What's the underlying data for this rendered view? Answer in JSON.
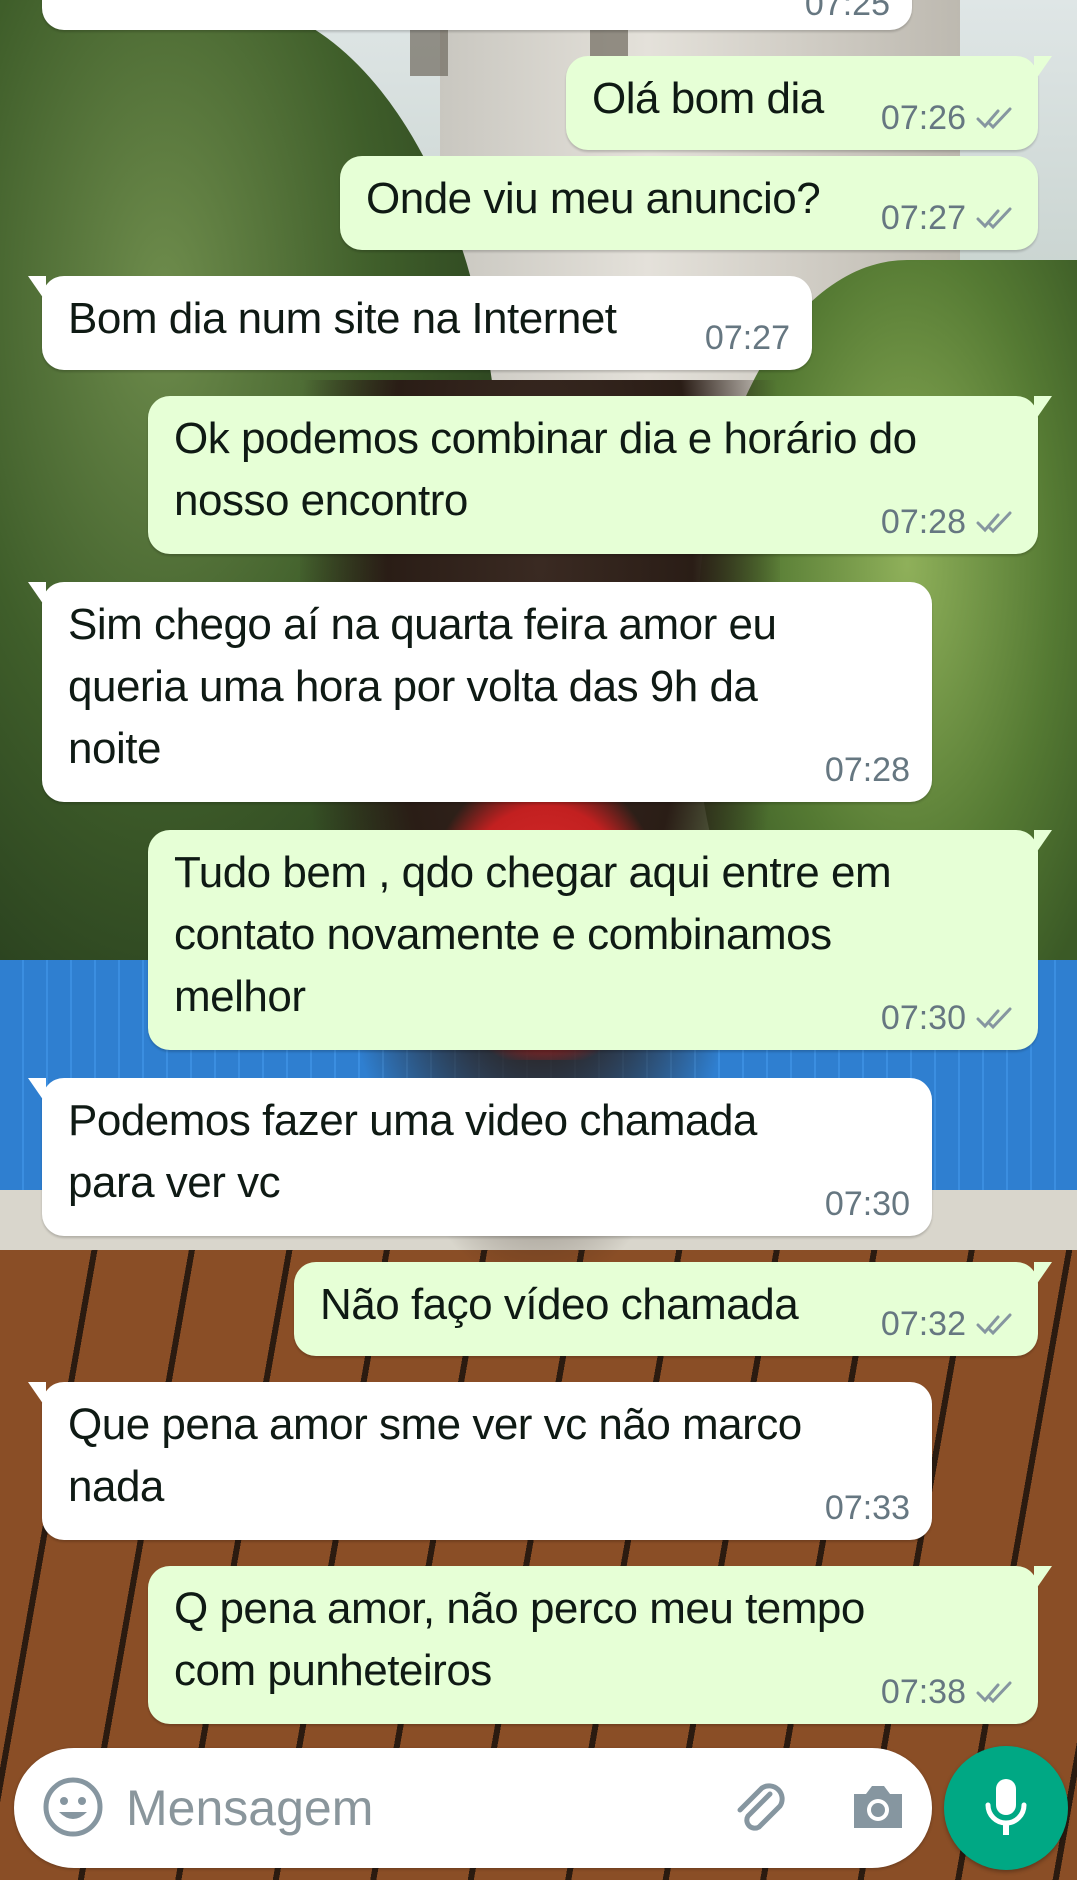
{
  "conversation": {
    "partial_top": {
      "time": "07:25"
    },
    "messages": [
      {
        "dir": "out",
        "text": "Olá bom dia",
        "time": "07:26"
      },
      {
        "dir": "out",
        "text": "Onde viu meu anuncio?",
        "time": "07:27"
      },
      {
        "dir": "in",
        "text": "Bom dia num site na Internet",
        "time": "07:27"
      },
      {
        "dir": "out",
        "text": "Ok podemos combinar dia e horário do\nnosso encontro",
        "time": "07:28"
      },
      {
        "dir": "in",
        "text": "Sim chego aí na quarta feira amor eu\nqueria uma hora por volta das 9h da\nnoite",
        "time": "07:28"
      },
      {
        "dir": "out",
        "text": "Tudo bem , qdo chegar aqui entre em\ncontato novamente e combinamos\nmelhor",
        "time": "07:30"
      },
      {
        "dir": "in",
        "text": "Podemos fazer uma video chamada\npara ver vc",
        "time": "07:30"
      },
      {
        "dir": "out",
        "text": "Não faço vídeo chamada",
        "time": "07:32"
      },
      {
        "dir": "in",
        "text": "Que pena amor sme ver vc não marco\nnada",
        "time": "07:33"
      },
      {
        "dir": "out",
        "text": "Q pena amor, não perco meu tempo\ncom punheteiros",
        "time": "07:38"
      }
    ]
  },
  "composer": {
    "placeholder": "Mensagem",
    "icons": [
      "emoji-icon",
      "attach-icon",
      "camera-icon",
      "mic-icon"
    ]
  },
  "colors": {
    "incoming_bubble": "#ffffff",
    "outgoing_bubble": "#e6ffd6",
    "timestamp": "#667781",
    "mic_button": "#00a884"
  }
}
